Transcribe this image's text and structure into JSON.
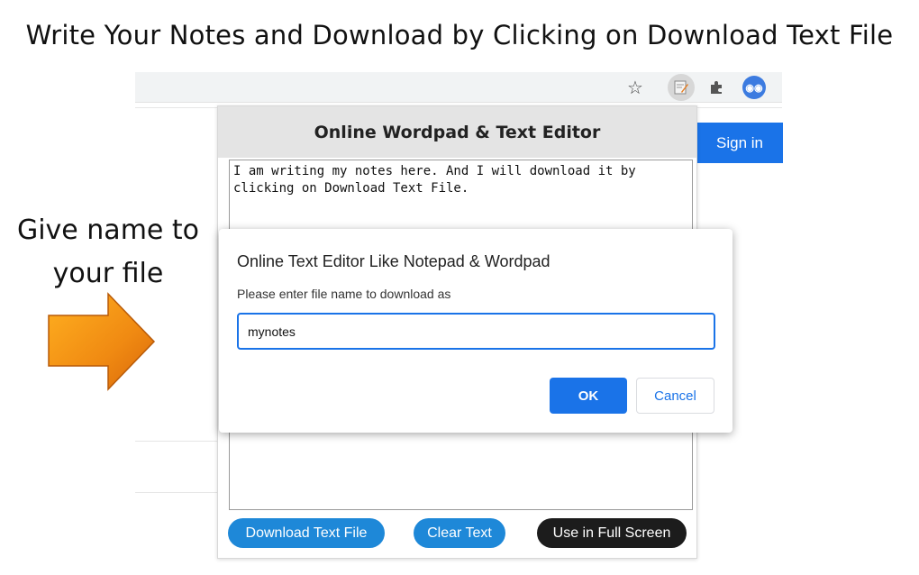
{
  "headline": "Write Your Notes and Download by Clicking on Download Text File",
  "callout": {
    "line1": "Give name to",
    "line2": "your file"
  },
  "browser": {
    "toolbar_icons": [
      "star-icon",
      "notepad-extension-icon",
      "puzzle-icon",
      "profile-icon"
    ],
    "sign_in_label": "Sign in"
  },
  "popup": {
    "title": "Online Wordpad & Text Editor",
    "editor_text": "I am writing my notes here. And I will download it by\nclicking on Download Text File.",
    "buttons": {
      "download": "Download Text File",
      "clear": "Clear Text",
      "full_screen": "Use in Full Screen"
    }
  },
  "dialog": {
    "title": "Online Text Editor Like Notepad & Wordpad",
    "message": "Please enter file name to download as",
    "input_value": "mynotes",
    "ok_label": "OK",
    "cancel_label": "Cancel"
  },
  "colors": {
    "accent_blue": "#1a73e8",
    "pill_blue": "#1e88d8",
    "pill_dark": "#1c1c1c",
    "arrow_orange": "#f08a12"
  }
}
